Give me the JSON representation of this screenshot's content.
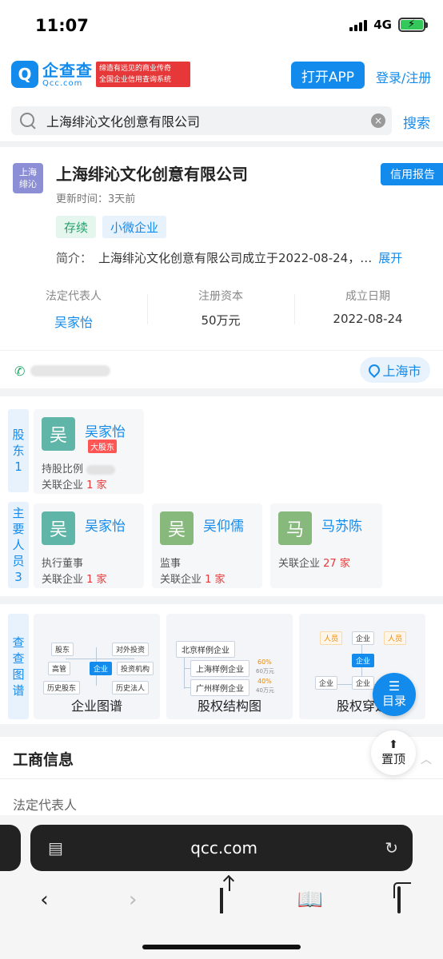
{
  "status_bar": {
    "time": "11:07",
    "network": "4G"
  },
  "header": {
    "logo_mark": "Q",
    "logo_cn": "企查查",
    "logo_en": "Qcc.com",
    "slogan_line1": "缔造有远见的商业传奇",
    "slogan_line2": "全国企业信用查询系统",
    "open_app": "打开APP",
    "login": "登录/注册"
  },
  "search": {
    "value": "上海绯沁文化创意有限公司",
    "clear": "×",
    "button": "搜索"
  },
  "company": {
    "avatar_line1": "上海",
    "avatar_line2": "绯沁",
    "name": "上海绯沁文化创意有限公司",
    "credit_report": "信用报告",
    "updated": "更新时间：3天前",
    "tags": [
      "存续",
      "小微企业"
    ],
    "intro_label": "简介：",
    "intro_text": "上海绯沁文化创意有限公司成立于2022-08-24，…",
    "intro_more": "展开",
    "stats": [
      {
        "label": "法定代表人",
        "value": "吴家怡"
      },
      {
        "label": "注册资本",
        "value": "50万元"
      },
      {
        "label": "成立日期",
        "value": "2022-08-24"
      }
    ],
    "location": "上海市"
  },
  "shareholders": {
    "side_label": [
      "股",
      "东",
      "1"
    ],
    "items": [
      {
        "avatar": "吴",
        "name": "吴家怡",
        "badge": "大股东",
        "line1": "持股比例",
        "line2_prefix": "关联企业",
        "line2_count": "1 家"
      }
    ]
  },
  "key_people": {
    "side_label": [
      "主",
      "要",
      "人",
      "员",
      "3"
    ],
    "items": [
      {
        "avatar": "吴",
        "name": "吴家怡",
        "role": "执行董事",
        "line2_prefix": "关联企业",
        "line2_count": "1 家",
        "color": "#5fb6a8"
      },
      {
        "avatar": "吴",
        "name": "吴仰儒",
        "role": "监事",
        "line2_prefix": "关联企业",
        "line2_count": "1 家",
        "color": "#86b97b"
      },
      {
        "avatar": "马",
        "name": "马苏陈",
        "role": "",
        "line2_prefix": "关联企业",
        "line2_count": "27 家",
        "color": "#86b97b"
      }
    ]
  },
  "graphs": {
    "side_label": [
      "查",
      "查",
      "图",
      "谱"
    ],
    "cards": [
      {
        "title": "企业图谱",
        "nodes": {
          "gudong": "股东",
          "duiwai": "对外投资",
          "gaoguan": "高管",
          "center": "企业",
          "touzi": "投资机构",
          "lishi_gudong": "历史股东",
          "lishi_faren": "历史法人"
        }
      },
      {
        "title": "股权结构图",
        "nodes": {
          "root": "北京样例企业",
          "child1": "上海样例企业",
          "child1_pct": "60%",
          "child1_amt": "60万元",
          "child2": "广州样例企业",
          "child2_pct": "40%",
          "child2_amt": "40万元"
        }
      },
      {
        "title": "股权穿透",
        "nodes": {
          "renyuan1": "人员",
          "qiye_top": "企业",
          "renyuan2": "人员",
          "center": "企业",
          "bottom1": "企业",
          "bottom2": "企业"
        }
      }
    ]
  },
  "floating": {
    "toc": "目录",
    "top": "置顶"
  },
  "business_info": {
    "title": "工商信息",
    "first_field": "法定代表人"
  },
  "browser": {
    "url": "qcc.com"
  }
}
